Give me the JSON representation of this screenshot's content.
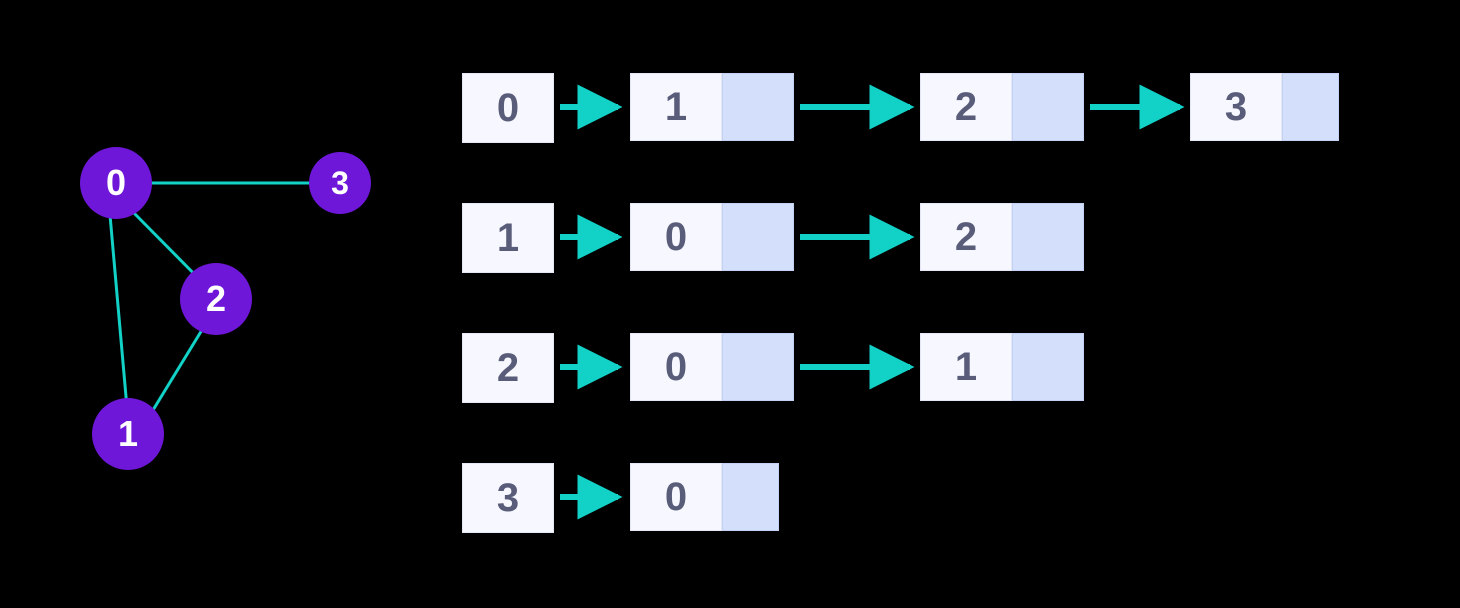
{
  "chart_data": {
    "type": "graph-adjacency-list",
    "graph": {
      "vertices": [
        "0",
        "1",
        "2",
        "3"
      ],
      "edges": [
        [
          "0",
          "1"
        ],
        [
          "0",
          "2"
        ],
        [
          "0",
          "3"
        ],
        [
          "1",
          "2"
        ]
      ]
    },
    "adjacency_list": [
      {
        "vertex": "0",
        "neighbors": [
          "1",
          "2",
          "3"
        ]
      },
      {
        "vertex": "1",
        "neighbors": [
          "0",
          "2"
        ]
      },
      {
        "vertex": "2",
        "neighbors": [
          "0",
          "1"
        ]
      },
      {
        "vertex": "3",
        "neighbors": [
          "0"
        ]
      }
    ],
    "colors": {
      "node_fill": "#6e17d9",
      "node_text": "#ffffff",
      "edge": "#12d1c6",
      "arrow": "#12d1c6",
      "box_bg": "#f7f8ff",
      "box_text": "#5a5d7a",
      "ptr_bg": "#d4e0fb"
    }
  },
  "graph_labels": {
    "n0": "0",
    "n1": "1",
    "n2": "2",
    "n3": "3"
  },
  "rows": {
    "r0": {
      "head": "0",
      "c0": "1",
      "c1": "2",
      "c2": "3"
    },
    "r1": {
      "head": "1",
      "c0": "0",
      "c1": "2"
    },
    "r2": {
      "head": "2",
      "c0": "0",
      "c1": "1"
    },
    "r3": {
      "head": "3",
      "c0": "0"
    }
  }
}
